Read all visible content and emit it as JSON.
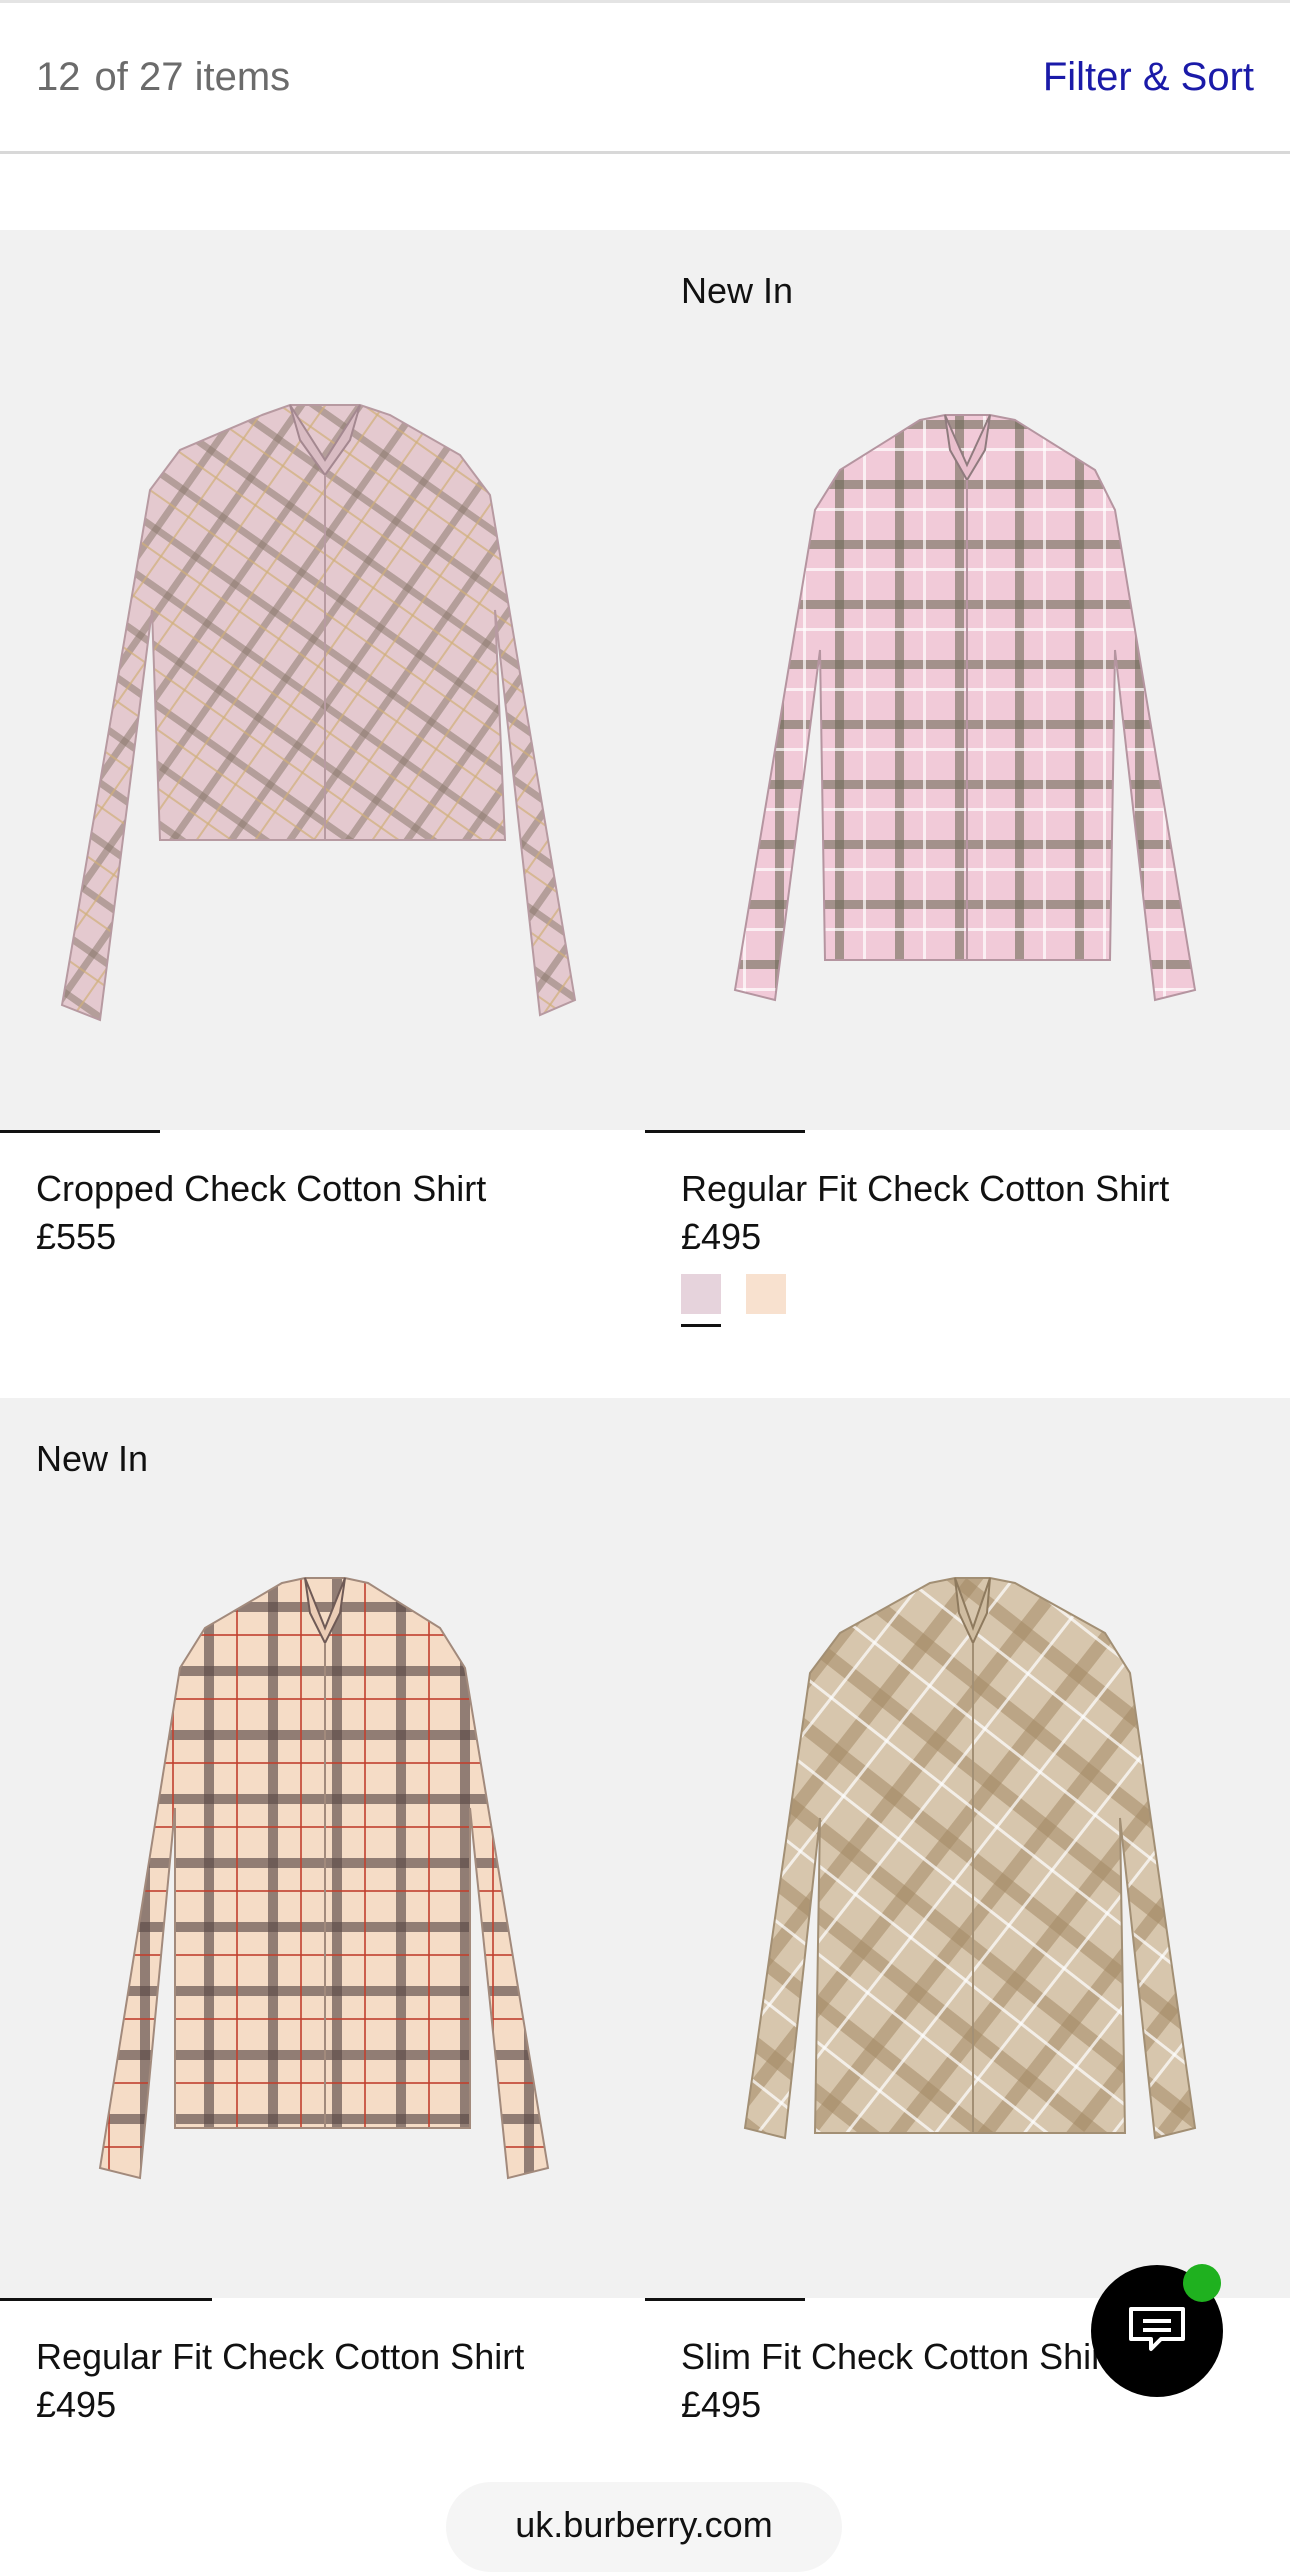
{
  "header": {
    "shown_count": "12",
    "count_suffix": "of 27 items",
    "filter_label": "Filter & Sort"
  },
  "products": [
    {
      "name": "Cropped Check Cotton Shirt",
      "price": "£555",
      "badge": "",
      "image_progress": 0.25
    },
    {
      "name": "Regular Fit Check Cotton Shirt",
      "price": "£495",
      "badge": "New In",
      "image_progress": 0.25,
      "swatches": [
        {
          "color": "#e6d3dc",
          "selected": true
        },
        {
          "color": "#f8e1cf",
          "selected": false
        }
      ]
    },
    {
      "name": "Regular Fit Check Cotton Shirt",
      "price": "£495",
      "badge": "New In",
      "image_progress": 0.33
    },
    {
      "name": "Slim Fit Check Cotton Shirt",
      "price": "£495",
      "badge": "",
      "image_progress": 0.25
    }
  ],
  "chat": {
    "icon": "chat-bubble-icon",
    "status_color": "#1fb11f"
  },
  "browser": {
    "url": "uk.burberry.com"
  },
  "colors": {
    "accent": "#1a1aa8",
    "text": "#111111",
    "muted": "#6b6b6b",
    "image_bg": "#f1f1f1"
  }
}
